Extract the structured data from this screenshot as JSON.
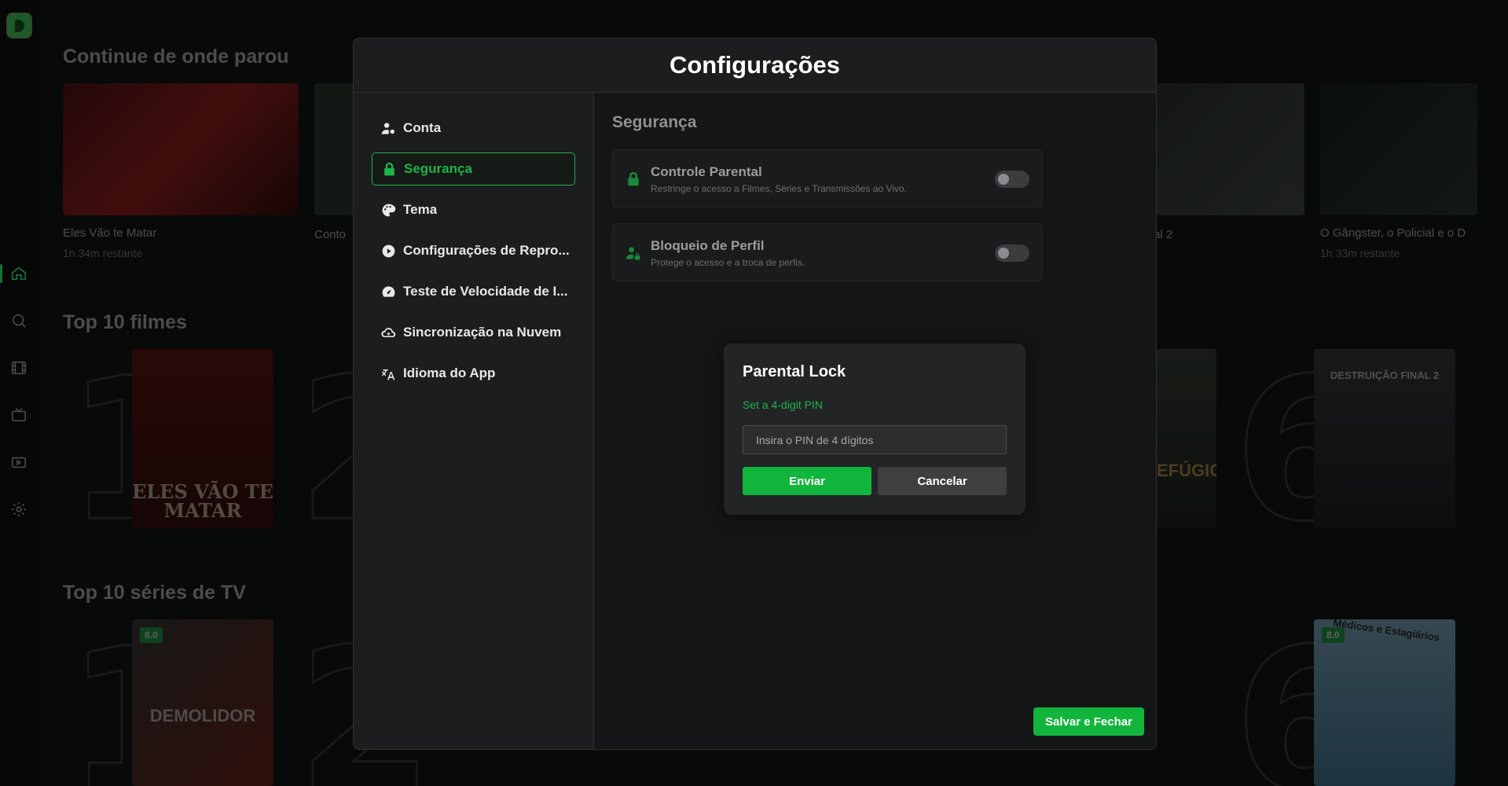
{
  "background": {
    "sections": [
      {
        "title": "Continue de onde parou"
      },
      {
        "title": "Top 10 filmes"
      },
      {
        "title": "Top 10 séries de TV"
      }
    ],
    "continue_items": [
      {
        "title": "Eles Vão te Matar",
        "remaining": "1h 34m restante"
      },
      {
        "title": "Conto"
      },
      {
        "title": "al 2"
      },
      {
        "title": "O Gângster, o Policial e o D",
        "remaining": "1h 33m restante"
      }
    ],
    "top_movies": {
      "poster_text_1": "ELES VÃO TE MATAR",
      "poster_text_2": "EFÚGIO",
      "poster_text_3": "DESTRUIÇÃO FINAL 2",
      "numbers": [
        "1",
        "2",
        "6"
      ]
    },
    "top_series": {
      "rating_1": "8.0",
      "rating_2": "8.0",
      "poster_text_1": "DEMOLIDOR",
      "poster_text_2": "Médicos e Estagiários",
      "numbers": [
        "1",
        "2",
        "6"
      ]
    }
  },
  "modal": {
    "title": "Configurações",
    "sidebar": [
      {
        "label": "Conta",
        "icon": "user-gear-icon"
      },
      {
        "label": "Segurança",
        "icon": "lock-icon",
        "active": true
      },
      {
        "label": "Tema",
        "icon": "palette-icon"
      },
      {
        "label": "Configurações de Repro...",
        "icon": "play-circle-icon"
      },
      {
        "label": "Teste de Velocidade de I...",
        "icon": "speedometer-icon"
      },
      {
        "label": "Sincronização na Nuvem",
        "icon": "cloud-sync-icon"
      },
      {
        "label": "Idioma do App",
        "icon": "translate-icon"
      }
    ],
    "content_title": "Segurança",
    "settings": [
      {
        "title": "Controle Parental",
        "desc": "Restringe o acesso a Filmes, Séries e Transmissões ao Vivo.",
        "enabled": false
      },
      {
        "title": "Bloqueio de Perfil",
        "desc": "Protege o acesso e a troca de perfis.",
        "enabled": false
      }
    ],
    "save_label": "Salvar e Fechar"
  },
  "pin_dialog": {
    "title": "Parental Lock",
    "subtitle": "Set a 4-digit PIN",
    "placeholder": "Insira o PIN de 4 dígitos",
    "value": "",
    "submit_label": "Enviar",
    "cancel_label": "Cancelar"
  },
  "colors": {
    "accent": "#1fb34a",
    "button": "#12b53c"
  }
}
